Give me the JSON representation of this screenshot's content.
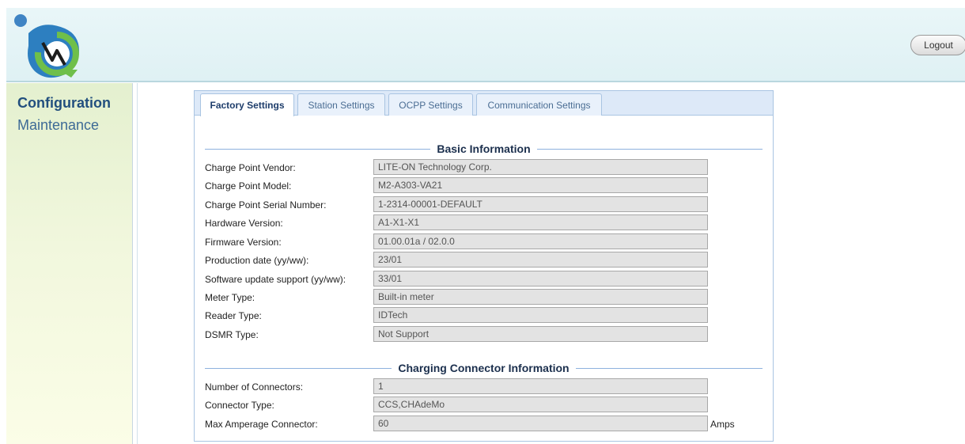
{
  "header": {
    "logout_label": "Logout"
  },
  "sidebar": {
    "items": [
      {
        "label": "Configuration"
      },
      {
        "label": "Maintenance"
      }
    ]
  },
  "tabs": [
    {
      "label": "Factory Settings",
      "active": true
    },
    {
      "label": "Station Settings",
      "active": false
    },
    {
      "label": "OCPP Settings",
      "active": false
    },
    {
      "label": "Communication Settings",
      "active": false
    }
  ],
  "basic": {
    "title": "Basic Information",
    "fields": [
      {
        "label": "Charge Point Vendor:",
        "value": "LITE-ON Technology Corp."
      },
      {
        "label": "Charge Point Model:",
        "value": "M2-A303-VA21"
      },
      {
        "label": "Charge Point Serial Number:",
        "value": "1-2314-00001-DEFAULT"
      },
      {
        "label": "Hardware Version:",
        "value": "A1-X1-X1"
      },
      {
        "label": "Firmware Version:",
        "value": "01.00.01a / 02.0.0"
      },
      {
        "label": "Production date (yy/ww):",
        "value": "23/01"
      },
      {
        "label": "Software update support (yy/ww):",
        "value": "33/01"
      },
      {
        "label": "Meter Type:",
        "value": "Built-in meter"
      },
      {
        "label": "Reader Type:",
        "value": "IDTech"
      },
      {
        "label": "DSMR Type:",
        "value": "Not Support"
      }
    ]
  },
  "connector": {
    "title": "Charging Connector Information",
    "fields": [
      {
        "label": "Number of Connectors:",
        "value": "1"
      },
      {
        "label": "Connector Type:",
        "value": "CCS,CHAdeMo"
      },
      {
        "label": "Max Amperage Connector:",
        "value": "60",
        "unit": "Amps"
      }
    ]
  },
  "colors": {
    "header_bg": "#e3f3f6",
    "sidebar_bg": "#eef6da",
    "tab_active_text": "#1e3d6b",
    "nav_text": "#224f7e"
  }
}
